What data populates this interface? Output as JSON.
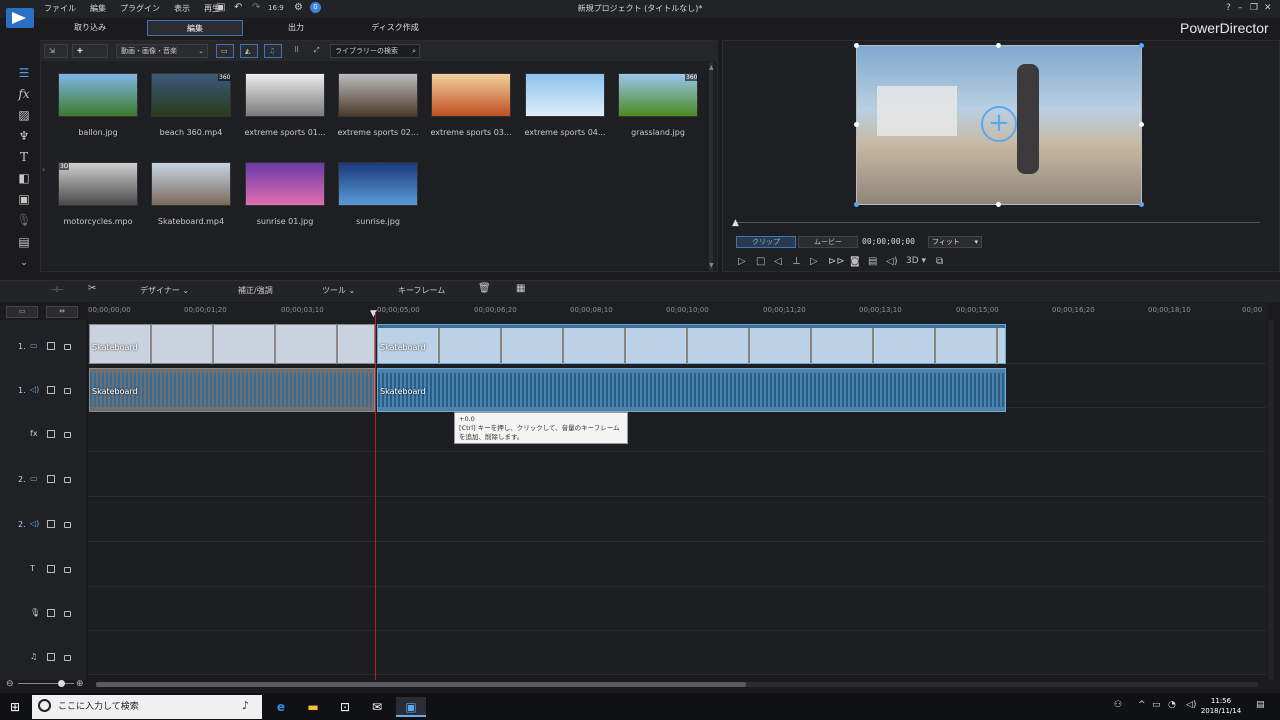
{
  "window": {
    "title": "新規プロジェクト (タイトルなし)*",
    "menu": [
      "ファイル",
      "編集",
      "プラグイン",
      "表示",
      "再生"
    ],
    "brand": "PowerDirector",
    "help": "?"
  },
  "quick": {
    "undo_icon": "undo-icon",
    "ratio": "16:9"
  },
  "mode_tabs": {
    "capture": "取り込み",
    "edit": "編集",
    "produce": "出力",
    "disc": "ディスク作成"
  },
  "library": {
    "filter": "動画・画像・音楽",
    "search_placeholder": "ライブラリーの検索",
    "items": [
      {
        "name": "ballon.jpg",
        "badge": "",
        "colors": [
          "#7fb6e8",
          "#3d7a2a"
        ]
      },
      {
        "name": "beach 360.mp4",
        "badge": "360",
        "colors": [
          "#3b5a7a",
          "#2a3a1c"
        ]
      },
      {
        "name": "extreme sports 01...",
        "badge": "",
        "colors": [
          "#ededed",
          "#7a7a7a"
        ]
      },
      {
        "name": "extreme sports 02...",
        "badge": "",
        "colors": [
          "#bcbcbc",
          "#4a3a2a"
        ]
      },
      {
        "name": "extreme sports 03...",
        "badge": "",
        "colors": [
          "#f1d0a0",
          "#c05020"
        ]
      },
      {
        "name": "extreme sports 04...",
        "badge": "",
        "colors": [
          "#8cc2ee",
          "#e0eef8"
        ]
      },
      {
        "name": "grassland.jpg",
        "badge": "360",
        "colors": [
          "#9cc6ee",
          "#4a8a20"
        ]
      },
      {
        "name": "motorcycles.mpo",
        "badge": "3D",
        "colors": [
          "#cfcfcf",
          "#4a4a4a"
        ]
      },
      {
        "name": "Skateboard.mp4",
        "badge": "",
        "colors": [
          "#c6d4e4",
          "#7a6a5a"
        ]
      },
      {
        "name": "sunrise 01.jpg",
        "badge": "",
        "colors": [
          "#6a3aa8",
          "#e070b0"
        ]
      },
      {
        "name": "sunrise.jpg",
        "badge": "",
        "colors": [
          "#1a3a7a",
          "#5a9ad8"
        ]
      }
    ]
  },
  "preview": {
    "clip": "クリップ",
    "movie": "ムービー",
    "timecode": "00;00;00;00",
    "fit": "フィット",
    "mode3d": "3D"
  },
  "timeline_tools": {
    "designer": "デザイナー",
    "fix": "補正/強調",
    "tools": "ツール",
    "keyframe": "キーフレーム"
  },
  "ruler": [
    "00;00;00;00",
    "00;00;01;20",
    "00;00;03;10",
    "00;00;05;00",
    "00;00;06;20",
    "00;00;08;10",
    "00;00;10;00",
    "00;00;11;20",
    "00;00;13;10",
    "00;00;15;00",
    "00;00;16;20",
    "00;00;18;10",
    "00;00"
  ],
  "tracks": [
    {
      "label": "1.",
      "icon": "video-track-icon"
    },
    {
      "label": "1.",
      "icon": "audio-track-icon"
    },
    {
      "label": "",
      "icon": "fx-track-icon"
    },
    {
      "label": "2.",
      "icon": "video-track-icon"
    },
    {
      "label": "2.",
      "icon": "audio-track-icon"
    },
    {
      "label": "",
      "icon": "title-track-icon"
    },
    {
      "label": "",
      "icon": "voice-track-icon"
    },
    {
      "label": "",
      "icon": "music-track-icon"
    }
  ],
  "clips": {
    "v1": "Skateboard",
    "v2": "Skateboard",
    "a1": "Skateboard",
    "a2": "Skateboard"
  },
  "tooltip": {
    "value": "+0.0",
    "text": "[Ctrl] キーを押し、クリックして、音量のキーフレームを追加、削除します。"
  },
  "taskbar": {
    "search_placeholder": "ここに入力して検索",
    "time": "11:56",
    "date": "2018/11/14"
  }
}
